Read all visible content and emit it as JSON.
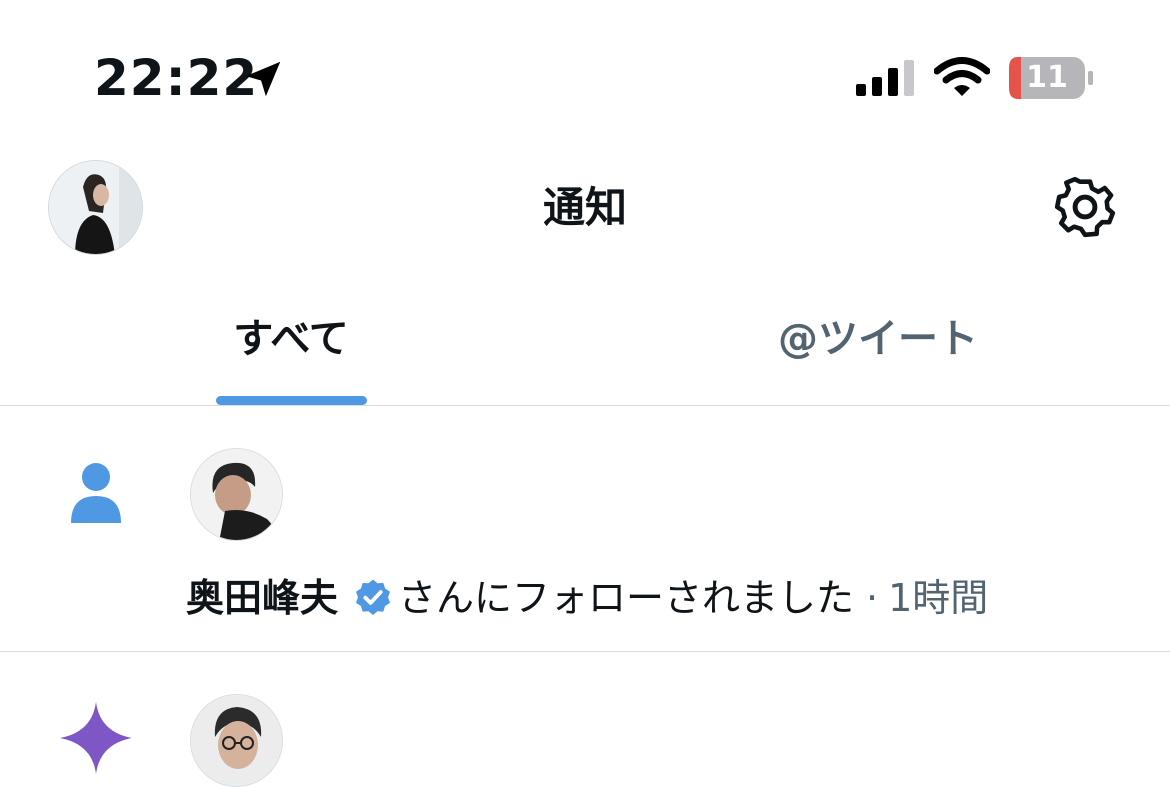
{
  "status_bar": {
    "time": "22:22",
    "battery_level": "11",
    "location_icon": "location-arrow-icon",
    "signal_icon": "cellular-signal-icon",
    "wifi_icon": "wifi-icon",
    "battery_icon": "battery-icon"
  },
  "header": {
    "title": "通知",
    "settings_icon": "gear-icon"
  },
  "tabs": [
    {
      "label": "すべて",
      "active": true
    },
    {
      "label": "@ツイート",
      "active": false
    }
  ],
  "notifications": [
    {
      "type_icon": "person-icon",
      "user_name": "奥田峰夫",
      "verified": true,
      "action_text": "さんにフォローされました",
      "separator": "·",
      "time": "1時間"
    },
    {
      "type_icon": "sparkle-icon"
    }
  ],
  "colors": {
    "accent": "#4f98e3",
    "verified": "#4f98e3",
    "sparkle": "#7e56c6",
    "muted_text": "#536471",
    "battery_low": "#e5534b"
  }
}
